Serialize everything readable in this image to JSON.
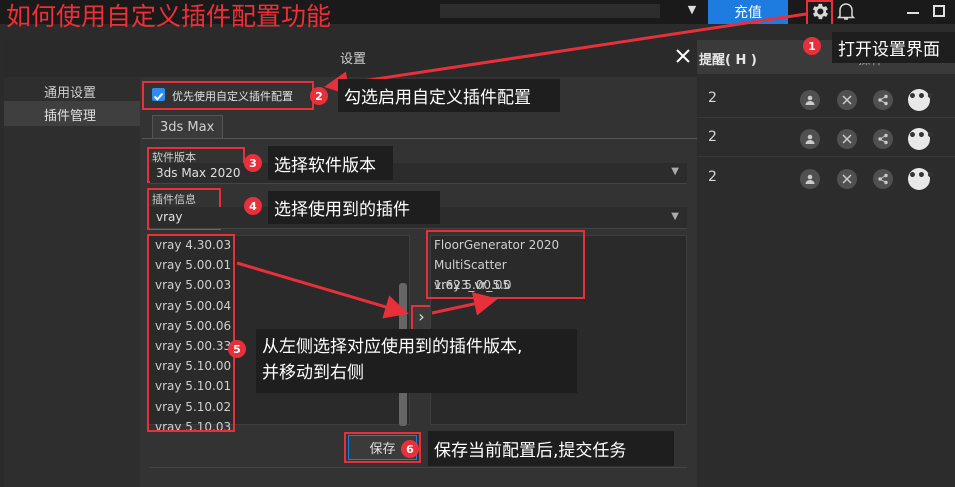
{
  "banner": {
    "title": "如何使用自定义插件配置功能"
  },
  "topbar": {
    "recharge_label": "充值"
  },
  "dialog": {
    "title": "设置"
  },
  "nav": {
    "items": [
      "通用设置",
      "插件管理"
    ]
  },
  "custom_config": {
    "label": "优先使用自定义插件配置",
    "checked": true
  },
  "software_tab": {
    "label": "3ds Max"
  },
  "software_version": {
    "label": "软件版本",
    "value": "3ds Max 2020"
  },
  "plugin_info": {
    "label": "插件信息",
    "value": "vray"
  },
  "available_plugins": [
    "vray 4.30.03",
    "vray 5.00.01",
    "vray 5.00.03",
    "vray 5.00.04",
    "vray 5.00.06",
    "vray 5.00.33",
    "vray 5.10.00",
    "vray 5.10.01",
    "vray 5.10.02",
    "vray 5.10.03"
  ],
  "selected_plugins": [
    "FloorGenerator 2020",
    "MultiScatter 1.623_vr_5.0",
    "vray 5.00.05"
  ],
  "move_button": {
    "symbol": "›"
  },
  "save_button": {
    "label": "保存"
  },
  "right_panel": {
    "col_remind": "提醒( H )",
    "col_ops": "操作",
    "rows": [
      {
        "value": "2"
      },
      {
        "value": "2"
      },
      {
        "value": "2"
      }
    ]
  },
  "annotations": {
    "step1": {
      "num": "1",
      "text": "打开设置界面"
    },
    "step2": {
      "num": "2",
      "text": "勾选启用自定义插件配置"
    },
    "step3": {
      "num": "3",
      "text": "选择软件版本"
    },
    "step4": {
      "num": "4",
      "text": "选择使用到的插件"
    },
    "step5": {
      "num": "5",
      "text_line1": "从左侧选择对应使用到的插件版本,",
      "text_line2": "并移动到右侧"
    },
    "step6": {
      "num": "6",
      "text": "保存当前配置后,提交任务"
    }
  },
  "colors": {
    "accent": "#1e7be0",
    "annotation_red": "#e8303a",
    "checkbox_blue": "#2d8cf0"
  }
}
